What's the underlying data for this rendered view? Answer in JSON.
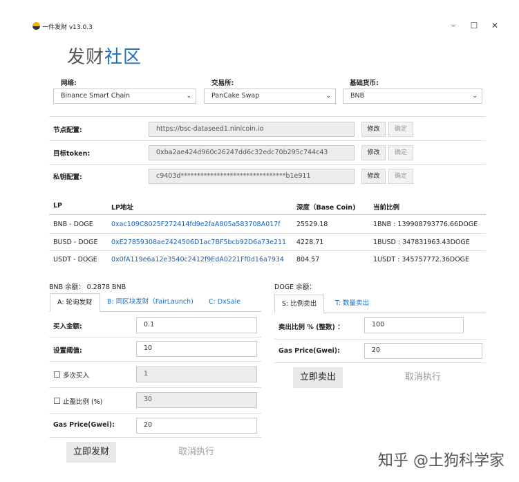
{
  "window": {
    "title": "一件发财 v13.0.3",
    "min_symbol": "–",
    "max_symbol": "☐",
    "close_symbol": "✕"
  },
  "brand": {
    "part1": "发财",
    "part2": "社区"
  },
  "network": {
    "label": "网络:",
    "value": "Binance Smart Chain"
  },
  "exchange": {
    "label": "交易所:",
    "value": "PanCake Swap"
  },
  "base": {
    "label": "基础货币:",
    "value": "BNB"
  },
  "config": {
    "node": {
      "label": "节点配置:",
      "value": "https://bsc-dataseed1.ninicoin.io"
    },
    "token": {
      "label": "目标token:",
      "value": "0xba2ae424d960c26247dd6c32edc70b295c744c43"
    },
    "key": {
      "label": "私钥配置:",
      "value": "c9403d********************************b1e911"
    },
    "edit_label": "修改",
    "confirm_label": "确定"
  },
  "lp_table": {
    "headers": [
      "LP",
      "LP地址",
      "深度（Base Coin)",
      "当前比例"
    ],
    "rows": [
      [
        "BNB - DOGE",
        "0xac109C8025F272414fd9e2faA805a583708A017f",
        "25529.18",
        "1BNB : 139908793776.66DOGE"
      ],
      [
        "BUSD - DOGE",
        "0xE27859308ae2424506D1ac7BF5bcb92D6a73e211",
        "4228.71",
        "1BUSD : 347831963.43DOGE"
      ],
      [
        "USDT - DOGE",
        "0x0fA119e6a12e3540c2412f9EdA0221Ff0d16a7934",
        "804.57",
        "1USDT : 345757772.36DOGE"
      ]
    ]
  },
  "left_panel": {
    "balance": "BNB 余额： 0.2878 BNB",
    "tabs": [
      "A: 轮询发财",
      "B: 同区块发财（FairLaunch)",
      "C: DxSale"
    ],
    "buy_amount": {
      "label": "买入金额:",
      "value": "0.1"
    },
    "threshold": {
      "label": "设置阈值:",
      "value": "10"
    },
    "multi_buy": {
      "label": "多次买入",
      "value": "1"
    },
    "take_profit": {
      "label": "止盈比例 (%)",
      "value": "30"
    },
    "gas": {
      "label": "Gas Price(Gwei):",
      "value": "20"
    },
    "execute": "立即发财",
    "cancel": "取消执行"
  },
  "right_panel": {
    "balance": "DOGE 余额：",
    "tabs": [
      "S: 比例卖出",
      "T: 数量卖出"
    ],
    "sell_ratio": {
      "label": "卖出比例 % (整数) ：",
      "value": "100"
    },
    "gas": {
      "label": "Gas Price(Gwei):",
      "value": "20"
    },
    "execute": "立即卖出",
    "cancel": "取消执行"
  },
  "watermark": "知乎 @土狗科学家",
  "colors": {
    "accent": "#1b6ec2",
    "link": "#1a5fb4",
    "logo_yellow": "#f2b300"
  }
}
